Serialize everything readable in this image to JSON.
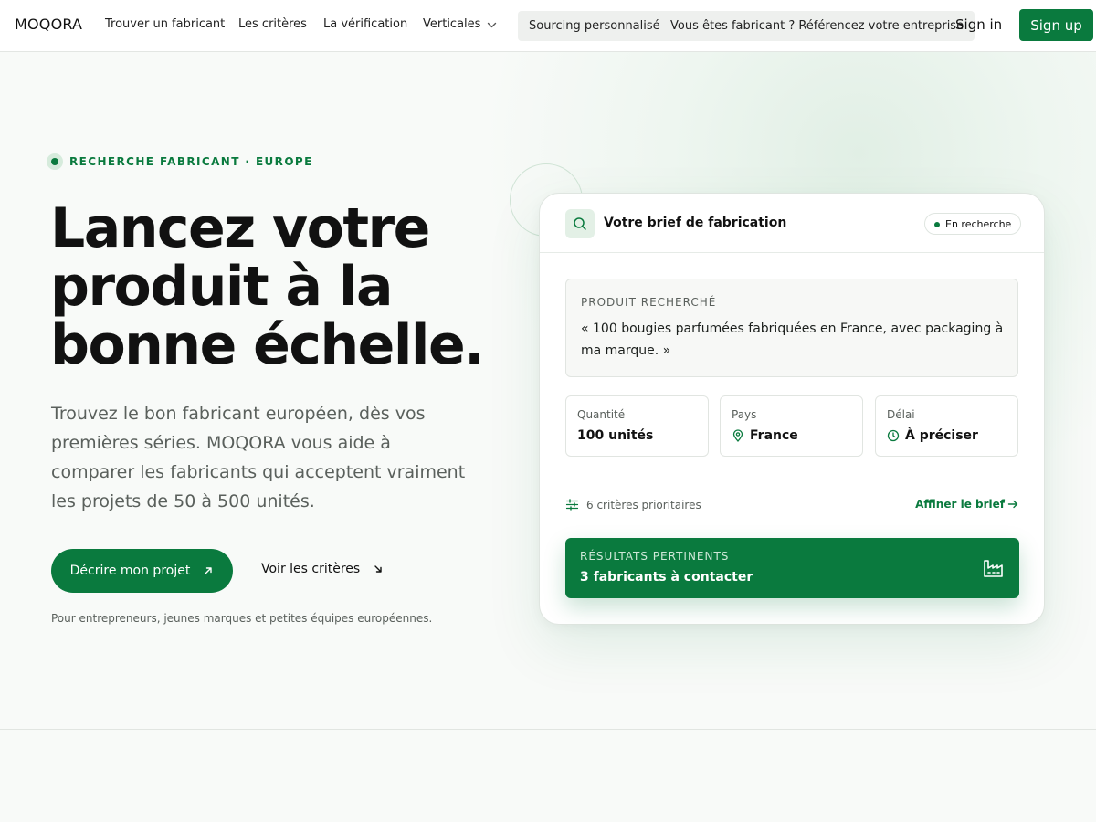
{
  "nav": {
    "logo": "MOQORA",
    "links": [
      "Trouver un fabricant",
      "Les critères",
      "La vérification",
      "Verticales"
    ],
    "sourcing": "Sourcing personnalisé",
    "manufacturer": "Vous êtes fabricant ? Référencez votre entreprise",
    "signin": "Sign in",
    "signup": "Sign up"
  },
  "hero": {
    "eyebrow": "RECHERCHE FABRICANT · EUROPE",
    "title": "Lancez votre produit à la bonne échelle.",
    "lead": "Trouvez le bon fabricant européen, dès vos premières séries. MOQORA vous aide à comparer les fabricants qui acceptent vraiment les projets de 50 à 500 unités.",
    "cta_primary": "Décrire mon projet",
    "cta_secondary": "Voir les critères",
    "note": "Pour entrepreneurs, jeunes marques et petites équipes européennes."
  },
  "card": {
    "title": "Votre brief de fabrication",
    "status": "En recherche",
    "product_label": "PRODUIT RECHERCHÉ",
    "product_text": "« 100 bougies parfumées fabriquées en France, avec packaging à ma marque. »",
    "stats": [
      {
        "label": "Quantité",
        "value": "100 unités"
      },
      {
        "label": "Pays",
        "value": "France"
      },
      {
        "label": "Délai",
        "value": "À préciser"
      }
    ],
    "criteria": "6 critères prioritaires",
    "refine": "Affiner le brief",
    "results_label": "RÉSULTATS PERTINENTS",
    "results_value": "3 fabricants à contacter"
  },
  "colors": {
    "brand_green": "#0a7a3e",
    "background": "#f8faf8"
  },
  "icons": {
    "chevron": "chevron-down-icon",
    "search": "search-icon",
    "arrow_up_right": "arrow-up-right-icon",
    "arrow_down_right": "arrow-down-right-icon",
    "pin": "map-pin-icon",
    "clock": "clock-icon",
    "sliders": "sliders-icon",
    "arrow_right": "arrow-right-icon",
    "factory": "factory-icon"
  }
}
